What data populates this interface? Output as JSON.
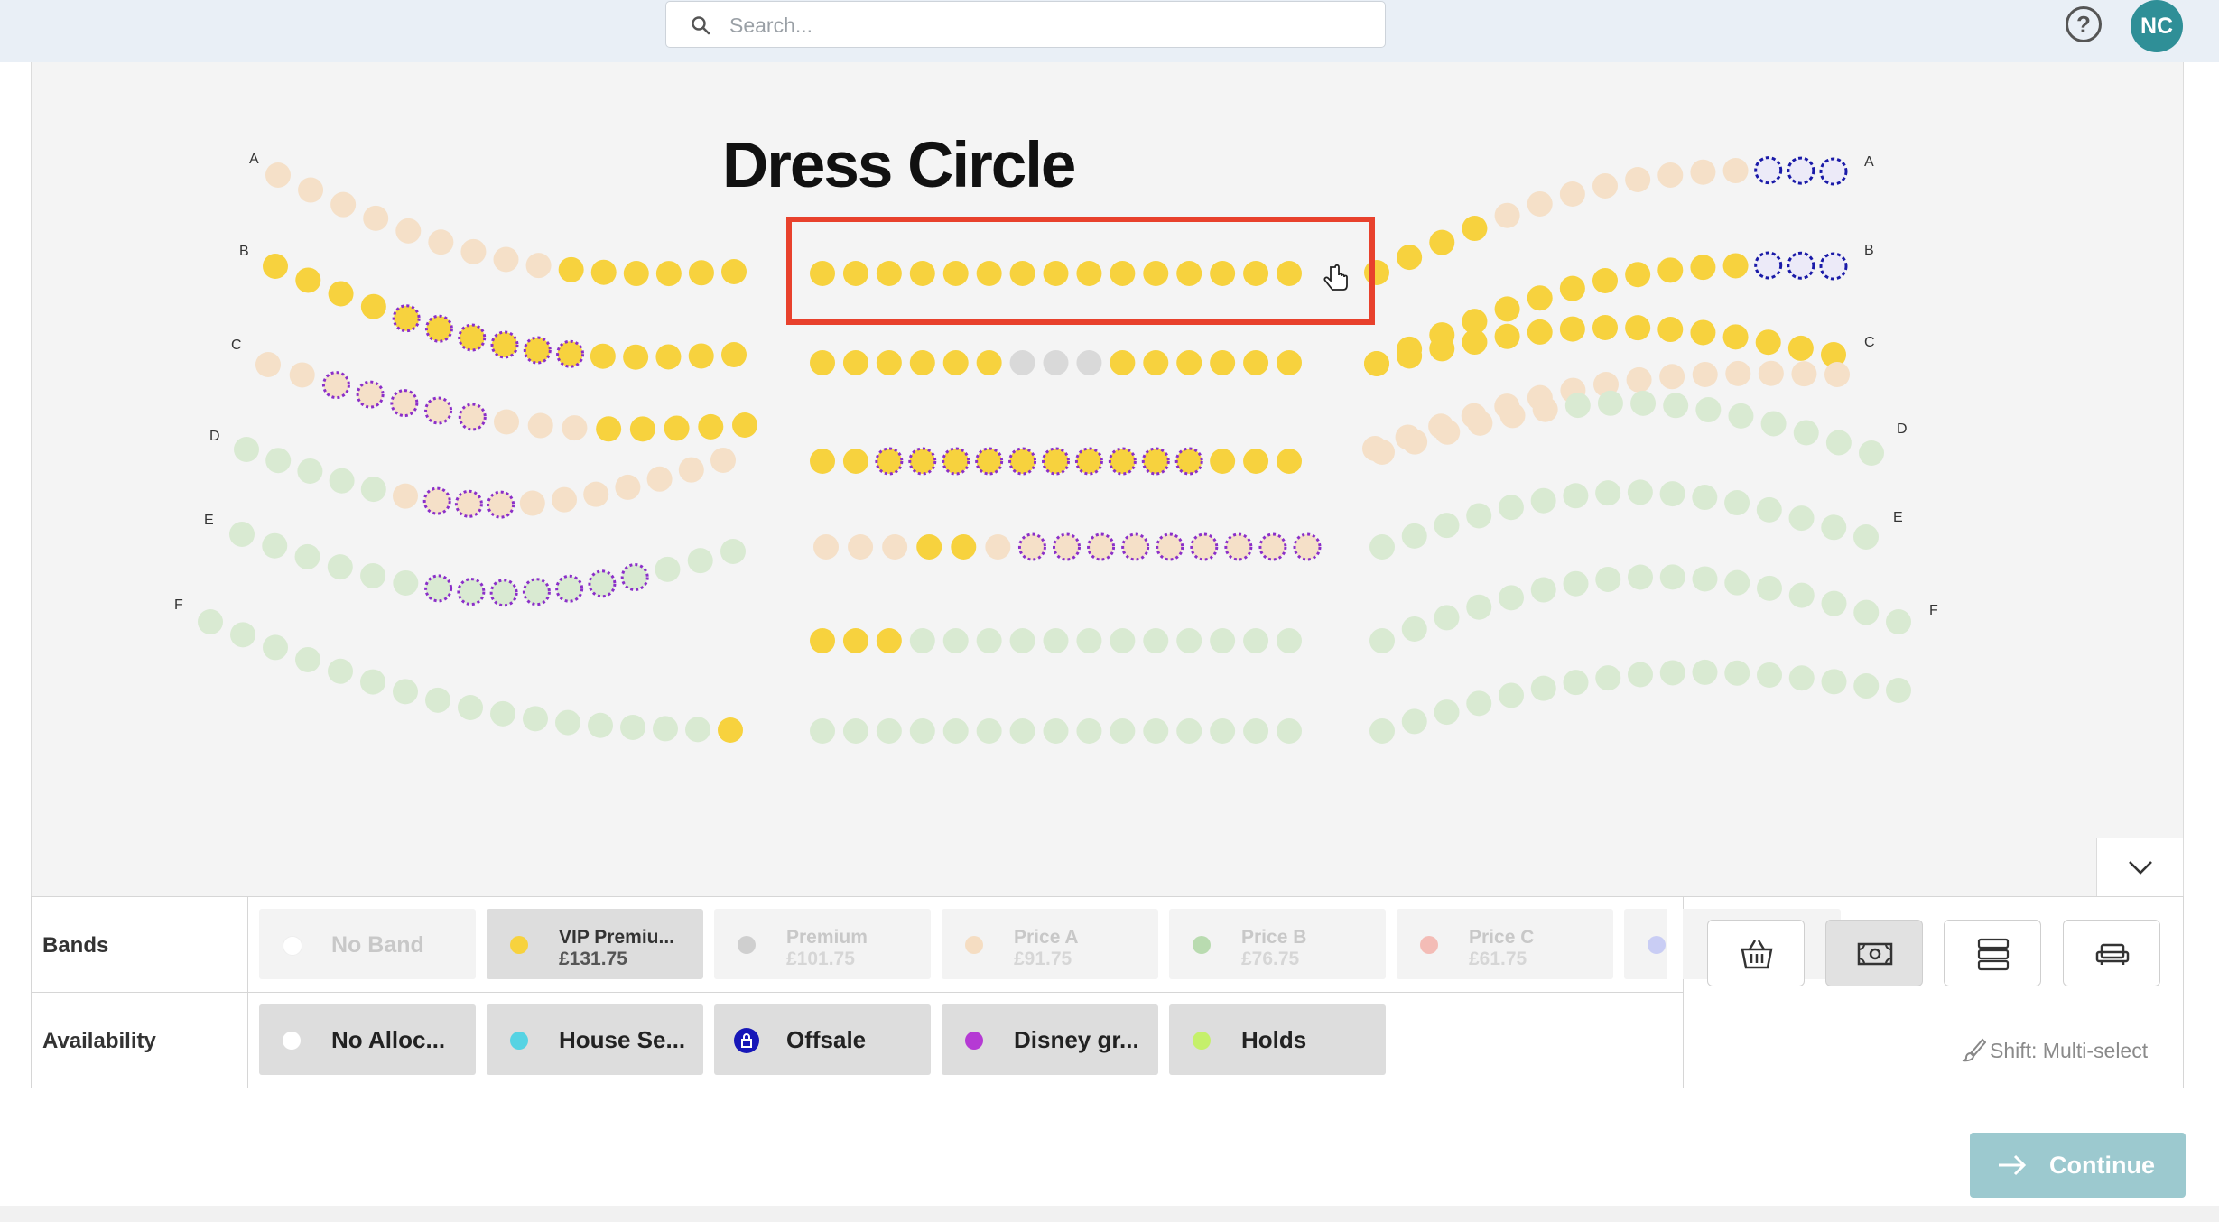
{
  "header": {
    "search_placeholder": "Search...",
    "help_label": "?",
    "avatar_initials": "NC"
  },
  "map": {
    "title": "Dress Circle",
    "row_labels": [
      "A",
      "B",
      "C",
      "D",
      "E",
      "F"
    ],
    "colors": {
      "vip": "#f7d23e",
      "premium": "#d9d9d9",
      "price_a": "#f5e0c8",
      "price_b": "#d9ead2",
      "hold_outline": "#8b2fc9",
      "offsale_outline": "#1a1aa8",
      "selection_box": "#e8412c"
    }
  },
  "bands": {
    "label": "Bands",
    "items": [
      {
        "name": "No Band",
        "price": "",
        "color": "#ffffff",
        "active": false
      },
      {
        "name": "VIP Premiu...",
        "price": "£131.75",
        "color": "#f7d23e",
        "active": true
      },
      {
        "name": "Premium",
        "price": "£101.75",
        "color": "#cfcfcf",
        "active": false
      },
      {
        "name": "Price A",
        "price": "£91.75",
        "color": "#f5ddc2",
        "active": false
      },
      {
        "name": "Price B",
        "price": "£76.75",
        "color": "#b9dbb0",
        "active": false
      },
      {
        "name": "Price C",
        "price": "£61.75",
        "color": "#f3bcb6",
        "active": false
      },
      {
        "name": "",
        "price": "",
        "color": "#c9cdf4",
        "active": false
      }
    ]
  },
  "availability": {
    "label": "Availability",
    "items": [
      {
        "name": "No Alloc...",
        "color": "#ffffff"
      },
      {
        "name": "House Se...",
        "color": "#56d3e3"
      },
      {
        "name": "Offsale",
        "color": "#1717b8"
      },
      {
        "name": "Disney gr...",
        "color": "#b53ad4"
      },
      {
        "name": "Holds",
        "color": "#c5f06b"
      }
    ]
  },
  "tools": [
    "basket-tool",
    "price-tool",
    "list-tool",
    "seat-tool"
  ],
  "hint": "Shift: Multi-select",
  "continue_label": "Continue"
}
